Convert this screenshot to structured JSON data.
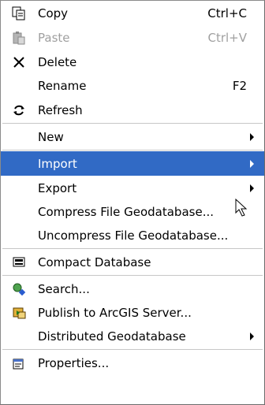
{
  "menu": {
    "items": [
      {
        "label": "Copy",
        "shortcut": "Ctrl+C",
        "icon": "copy-icon"
      },
      {
        "label": "Paste",
        "shortcut": "Ctrl+V",
        "icon": "paste-icon",
        "disabled": true
      },
      {
        "label": "Delete",
        "icon": "delete-icon"
      },
      {
        "label": "Rename",
        "shortcut": "F2"
      },
      {
        "label": "Refresh",
        "icon": "refresh-icon"
      },
      {
        "label": "New",
        "submenu": true
      },
      {
        "label": "Import",
        "submenu": true,
        "selected": true
      },
      {
        "label": "Export",
        "submenu": true
      },
      {
        "label": "Compress File Geodatabase..."
      },
      {
        "label": "Uncompress File Geodatabase..."
      },
      {
        "label": "Compact Database",
        "icon": "compact-database-icon"
      },
      {
        "label": "Search...",
        "icon": "search-icon"
      },
      {
        "label": "Publish to ArcGIS Server...",
        "icon": "publish-icon"
      },
      {
        "label": "Distributed Geodatabase",
        "submenu": true
      },
      {
        "label": "Properties...",
        "icon": "properties-icon"
      }
    ]
  },
  "colors": {
    "highlight": "#316ac5",
    "disabled_text": "#a0a0a0",
    "separator": "#c7c7c7"
  }
}
